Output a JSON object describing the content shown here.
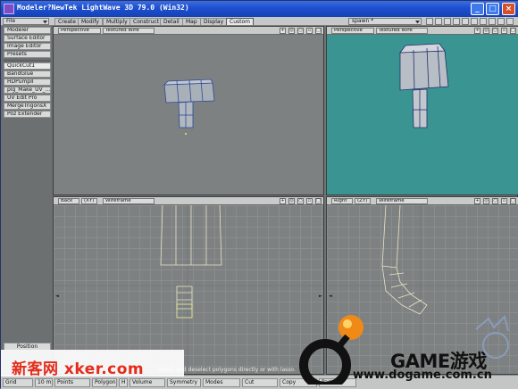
{
  "window": {
    "title": "Modeler?NewTek LightWave 3D 79.0 (Win32)",
    "buttons": {
      "minimize": "_",
      "maximize": "□",
      "close": "×"
    }
  },
  "menubar": {
    "file": "File",
    "tabs": [
      "Create",
      "Modify",
      "Multiply",
      "Construct",
      "Detail",
      "Map",
      "Display",
      "Custom"
    ],
    "active_tab": "Custom",
    "spawn": "spawn *"
  },
  "sidebar": {
    "top": [
      "Modeler",
      "Surface Editor",
      "Image Editor",
      "Presets"
    ],
    "plugins": [
      "QuickCut1",
      "BandGlue",
      "HDPumpII",
      "plg_Make_UV_...",
      "UV Edit Pro",
      "MergeTrigonsX",
      "Poz Extender"
    ],
    "position": "Position"
  },
  "viewports": {
    "top_left": {
      "view": "Perspective",
      "shading": "Textured Wire"
    },
    "top_right": {
      "view": "Perspective",
      "shading": "Textured Wire"
    },
    "bottom_left": {
      "view": "Back",
      "axes": "(XY)",
      "shading": "Wireframe"
    },
    "bottom_right": {
      "view": "Right",
      "axes": "(ZY)",
      "shading": "Wireframe"
    }
  },
  "statusbar": {
    "items": [
      "Grid",
      "10 m",
      "Points",
      "Polygons",
      "H",
      "Volume",
      "Symmetry",
      "Modes",
      "Cut",
      "Copy",
      "Paste"
    ],
    "hint": "Select and deselect polygons directly or with lasso."
  },
  "watermark": {
    "left": "新客网 xker.com",
    "brand": "GAME游戏",
    "url": "www.dogame.com.cn"
  },
  "colors": {
    "titlebar": "#1d4fcf",
    "viewport_bg": "#7e8181",
    "viewport_cyan": "#3a9592",
    "sidebar": "#6c7070",
    "watermark_red": "#e52b1a"
  }
}
